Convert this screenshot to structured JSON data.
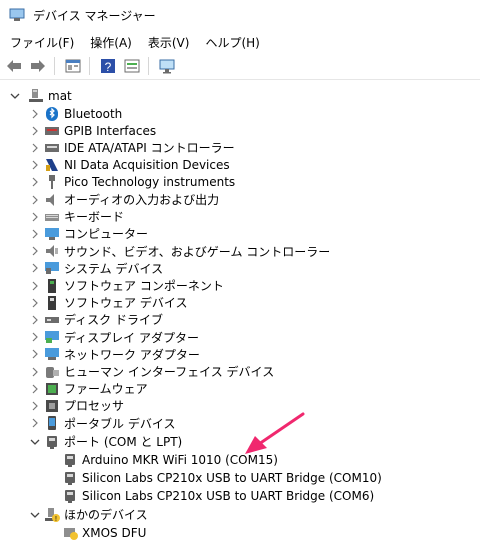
{
  "window": {
    "title": "デバイス マネージャー"
  },
  "menu": {
    "file": "ファイル(F)",
    "action": "操作(A)",
    "view": "表示(V)",
    "help": "ヘルプ(H)"
  },
  "tree": {
    "root": "mat",
    "categories": [
      {
        "label": "Bluetooth",
        "icon": "bluetooth-icon"
      },
      {
        "label": "GPIB Interfaces",
        "icon": "gpib-icon"
      },
      {
        "label": "IDE ATA/ATAPI コントローラー",
        "icon": "ide-controller-icon"
      },
      {
        "label": "NI Data Acquisition Devices",
        "icon": "ni-daq-icon"
      },
      {
        "label": "Pico Technology instruments",
        "icon": "pico-instrument-icon"
      },
      {
        "label": "オーディオの入力および出力",
        "icon": "speaker-icon"
      },
      {
        "label": "キーボード",
        "icon": "keyboard-icon"
      },
      {
        "label": "コンピューター",
        "icon": "computer-icon"
      },
      {
        "label": "サウンド、ビデオ、およびゲーム コントローラー",
        "icon": "sound-icon"
      },
      {
        "label": "システム デバイス",
        "icon": "system-device-icon"
      },
      {
        "label": "ソフトウェア コンポーネント",
        "icon": "software-component-icon"
      },
      {
        "label": "ソフトウェア デバイス",
        "icon": "software-device-icon"
      },
      {
        "label": "ディスク ドライブ",
        "icon": "disk-drive-icon"
      },
      {
        "label": "ディスプレイ アダプター",
        "icon": "display-adapter-icon"
      },
      {
        "label": "ネットワーク アダプター",
        "icon": "network-adapter-icon"
      },
      {
        "label": "ヒューマン インターフェイス デバイス",
        "icon": "hid-icon"
      },
      {
        "label": "ファームウェア",
        "icon": "firmware-icon"
      },
      {
        "label": "プロセッサ",
        "icon": "processor-icon"
      },
      {
        "label": "ポータブル デバイス",
        "icon": "portable-device-icon"
      }
    ],
    "ports": {
      "label": "ポート (COM と LPT)",
      "children": [
        "Arduino MKR WiFi 1010 (COM15)",
        "Silicon Labs CP210x USB to UART Bridge (COM10)",
        "Silicon Labs CP210x USB to UART Bridge (COM6)"
      ]
    },
    "other": {
      "label": "ほかのデバイス",
      "children": [
        "XMOS DFU"
      ]
    }
  },
  "colors": {
    "arrow": "#f0286e",
    "accent": "#1a73c8"
  }
}
